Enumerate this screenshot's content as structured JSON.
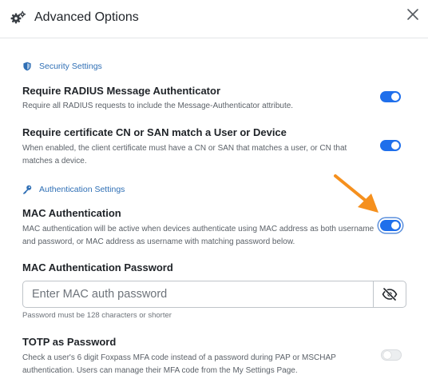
{
  "header": {
    "title": "Advanced Options",
    "icon": "gears-icon",
    "close_icon": "close-icon"
  },
  "security_section": {
    "label": "Security Settings",
    "icon": "shield-icon",
    "settings": [
      {
        "title": "Require RADIUS Message Authenticator",
        "description": "Require all RADIUS requests to include the Message-Authenticator attribute.",
        "enabled": true
      },
      {
        "title": "Require certificate CN or SAN match a User or Device",
        "description": "When enabled, the client certificate must have a CN or SAN that matches a user, or CN that matches a device.",
        "enabled": true
      }
    ]
  },
  "auth_section": {
    "label": "Authentication Settings",
    "icon": "key-icon",
    "mac_auth": {
      "title": "MAC Authentication",
      "description": "MAC authentication will be active when devices authenticate using MAC address as both username and password, or MAC address as username with matching password below.",
      "enabled": true
    },
    "mac_password": {
      "title": "MAC Authentication Password",
      "placeholder": "Enter MAC auth password",
      "value": "",
      "helper": "Password must be 128 characters or shorter",
      "visibility_icon": "eye-slash-icon"
    },
    "totp": {
      "title": "TOTP as Password",
      "description": "Check a user's 6 digit Foxpass MFA code instead of a password during PAP or MSCHAP authentication. Users can manage their MFA code from the My Settings Page.",
      "enabled": false
    }
  },
  "colors": {
    "accent": "#1f6feb",
    "section_label": "#2f6fb5",
    "annotation_arrow": "#f5901e"
  }
}
